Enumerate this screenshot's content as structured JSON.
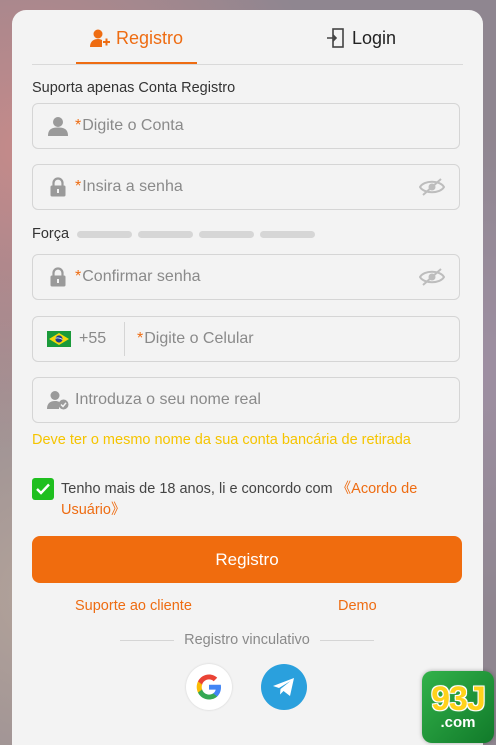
{
  "tabs": {
    "register": "Registro",
    "login": "Login"
  },
  "support_only": "Suporta apenas Conta Registro",
  "fields": {
    "account": {
      "required_mark": "*",
      "placeholder": "Digite o Conta"
    },
    "password": {
      "required_mark": "*",
      "placeholder": "Insira a senha"
    },
    "confirm": {
      "required_mark": "*",
      "placeholder": "Confirmar senha"
    },
    "phone": {
      "country_code": "+55",
      "required_mark": "*",
      "placeholder": "Digite o Celular"
    },
    "real_name": {
      "placeholder": "Introduza o seu nome real"
    }
  },
  "strength_label": "Força",
  "strength_levels": 4,
  "real_name_hint": "Deve ter o mesmo nome da sua conta bancária de retirada",
  "agreement": {
    "checked": true,
    "text": "Tenho mais de 18 anos, li e concordo com ",
    "link": "《Acordo de Usuário》"
  },
  "submit_label": "Registro",
  "links": {
    "support": "Suporte ao cliente",
    "demo": "Demo"
  },
  "bind_label": "Registro vinculativo",
  "social": [
    "google-icon",
    "telegram-icon"
  ],
  "brand": {
    "number": "93J",
    "domain": ".com"
  },
  "colors": {
    "accent": "#ee6c12",
    "hint": "#f5c400",
    "check": "#1fbf1f",
    "telegram": "#2aa0dd"
  }
}
